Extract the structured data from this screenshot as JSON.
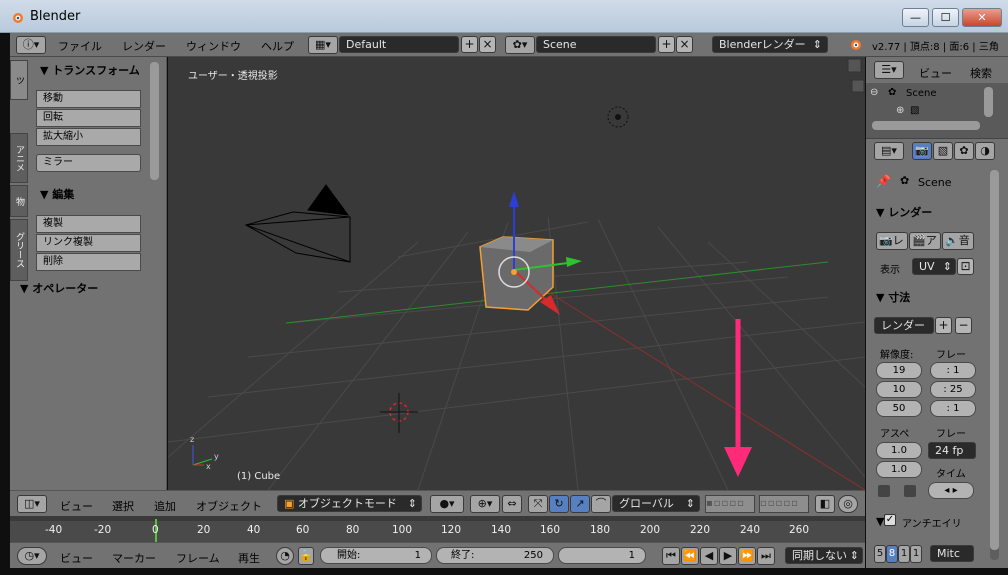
{
  "window": {
    "title": "Blender",
    "controls": {
      "minimize": "—",
      "maximize": "☐",
      "close": "✕"
    }
  },
  "topbar": {
    "menus": [
      "ファイル",
      "レンダー",
      "ウィンドウ",
      "ヘルプ"
    ],
    "layout_value": "Default",
    "scene_value": "Scene",
    "engine_value": "Blenderレンダー",
    "stats": "v2.77 | 頂点:8 | 面:6 | 三角"
  },
  "toolshelf": {
    "tabs": [
      "ツ",
      "アニメ",
      "物",
      "グリース"
    ],
    "transform_header": "▼ トランスフォーム",
    "transform_buttons": [
      "移動",
      "回転",
      "拡大縮小"
    ],
    "mirror_button": "ミラー",
    "edit_header": "▼ 編集",
    "edit_buttons": [
      "複製",
      "リンク複製",
      "削除"
    ],
    "operator_header": "▼ オペレーター"
  },
  "viewport": {
    "view_label": "ユーザー・透視投影",
    "object_label": "(1) Cube",
    "axis_labels": {
      "x": "x",
      "y": "y",
      "z": "z"
    }
  },
  "vp_header": {
    "menus": [
      "ビュー",
      "選択",
      "追加",
      "オブジェクト"
    ],
    "mode": "オブジェクトモード",
    "orientation": "グローバル"
  },
  "timeline": {
    "ticks": [
      "-40",
      "-20",
      "0",
      "20",
      "40",
      "60",
      "80",
      "100",
      "120",
      "140",
      "160",
      "180",
      "200",
      "220",
      "240",
      "260"
    ]
  },
  "bottombar": {
    "menus": [
      "ビュー",
      "マーカー",
      "フレーム",
      "再生"
    ],
    "start_label": "開始:",
    "start_value": "1",
    "end_label": "終了:",
    "end_value": "250",
    "current_frame": "1",
    "sync": "同期しない"
  },
  "outliner": {
    "menus": [
      "ビュー",
      "検索"
    ],
    "scene_item": "Scene"
  },
  "properties": {
    "context": "Scene",
    "render_header": "▼ レンダー",
    "render_buttons": [
      "レ",
      "ア",
      "音"
    ],
    "display_label": "表示",
    "display_value": "UV",
    "dimensions_header": "▼ 寸法",
    "preset_value": "レンダー",
    "resolution_label": "解像度:",
    "frame_label": "フレー",
    "res_x": "19",
    "res_y": "10",
    "res_pct": "50",
    "frame_start": ": 1",
    "frame_end": ": 25",
    "frame_step": ": 1",
    "aspect_label": "アスペ",
    "aspect_x": "1.0",
    "aspect_y": "1.0",
    "fps_label": "フレー",
    "fps_value": "24 fp",
    "time_label": "タイム",
    "aa_header": "アンチエイリ",
    "aa_samples": [
      "5",
      "8",
      "1",
      "1"
    ],
    "aa_filter": "Mitc"
  }
}
